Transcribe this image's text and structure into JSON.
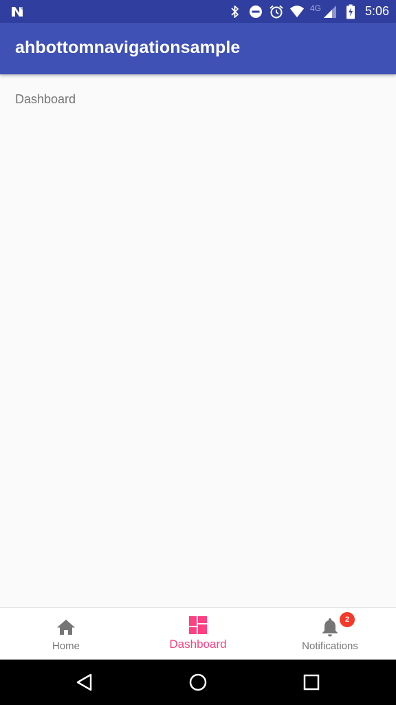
{
  "status_bar": {
    "time": "5:06",
    "network_type": "4G",
    "icons": [
      "n-notification-icon",
      "bluetooth-icon",
      "do-not-disturb-icon",
      "alarm-icon",
      "wifi-icon",
      "cell-signal-icon",
      "battery-charging-icon"
    ]
  },
  "app_bar": {
    "title": "ahbottomnavigationsample"
  },
  "content": {
    "label": "Dashboard"
  },
  "bottom_nav": {
    "items": [
      {
        "label": "Home",
        "icon": "home-icon",
        "active": false
      },
      {
        "label": "Dashboard",
        "icon": "dashboard-icon",
        "active": true
      },
      {
        "label": "Notifications",
        "icon": "bell-icon",
        "active": false,
        "badge": "2"
      }
    ],
    "active_color": "#FF4081",
    "inactive_color": "#757575",
    "badge_color": "#F4392A"
  },
  "colors": {
    "status_bar": "#303F9F",
    "app_bar": "#3F51B5",
    "background": "#FAFAFA"
  },
  "system_nav": {
    "buttons": [
      "back-icon",
      "home-circle-icon",
      "recents-icon"
    ]
  }
}
